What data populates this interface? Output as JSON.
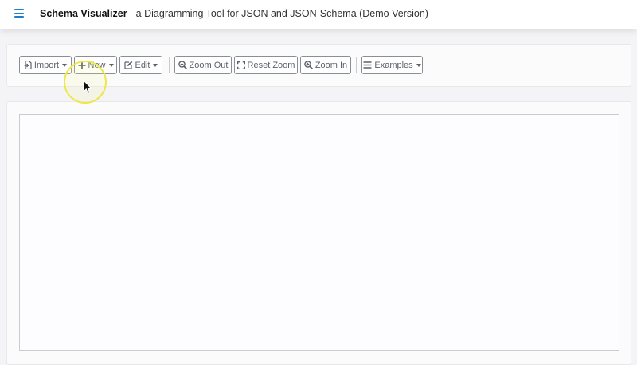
{
  "header": {
    "app_name": "Schema Visualizer",
    "subtitle": "- a Diagramming Tool for JSON and JSON-Schema (Demo Version)",
    "menu_icon": "hamburger-icon",
    "accent_color": "#1a7fd0"
  },
  "toolbar": {
    "import_label": "Import",
    "new_label": "New",
    "edit_label": "Edit",
    "zoom_out_label": "Zoom Out",
    "reset_zoom_label": "Reset Zoom",
    "zoom_in_label": "Zoom In",
    "examples_label": "Examples"
  },
  "icons": {
    "import": "import-file-icon",
    "new": "plus-icon",
    "edit": "edit-icon",
    "zoom_out": "zoom-out-icon",
    "reset_zoom": "expand-icon",
    "zoom_in": "zoom-in-icon",
    "examples": "list-icon"
  }
}
